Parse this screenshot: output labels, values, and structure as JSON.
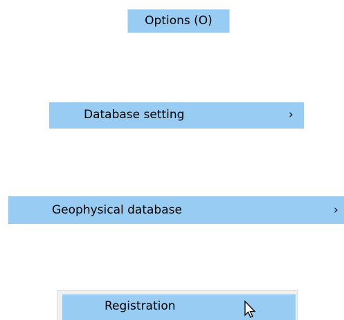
{
  "options_menu": {
    "label": "Options (O)"
  },
  "database_setting": {
    "label": "Database setting",
    "submenu_indicator": "›"
  },
  "geophysical_database": {
    "label": "Geophysical database",
    "submenu_indicator": "›"
  },
  "registration": {
    "label": "Registration"
  },
  "colors": {
    "highlight": "#99ccf3",
    "background": "#ffffff"
  },
  "icons": {
    "cursor": "arrow-cursor-icon"
  }
}
